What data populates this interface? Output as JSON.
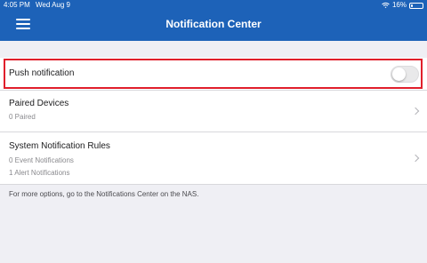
{
  "status_bar": {
    "time": "4:05 PM",
    "date": "Wed Aug 9",
    "battery_text": "16%",
    "battery_level": 0.16
  },
  "header": {
    "title": "Notification Center",
    "color": "#1d62b8"
  },
  "push": {
    "label": "Push notification",
    "enabled": false
  },
  "paired_devices": {
    "title": "Paired Devices",
    "subtitle": "0 Paired"
  },
  "rules": {
    "title": "System Notification Rules",
    "event_line": "0 Event Notifications",
    "alert_line": "1 Alert Notifications"
  },
  "footer": {
    "note": "For more options, go to the Notifications Center on the NAS."
  },
  "colors": {
    "highlight": "#e01f2b",
    "background": "#efeff4"
  }
}
